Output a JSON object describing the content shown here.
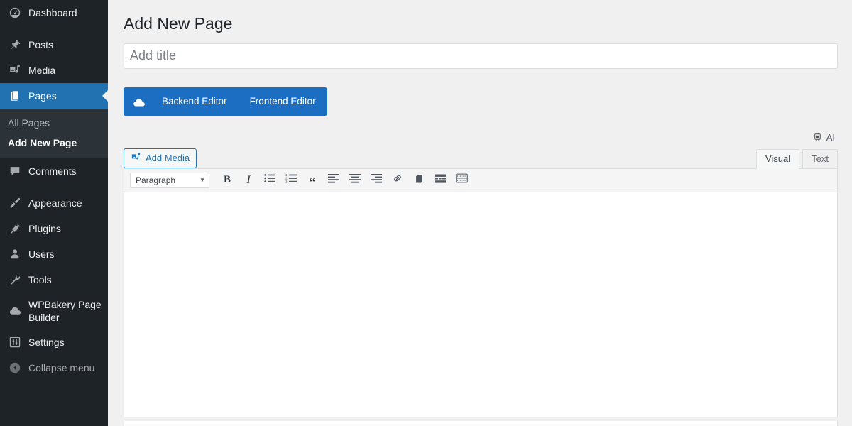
{
  "sidebar": {
    "items": [
      {
        "label": "Dashboard",
        "icon": "dashboard-icon",
        "current": false
      },
      {
        "label": "Posts",
        "icon": "pin-icon",
        "current": false
      },
      {
        "label": "Media",
        "icon": "media-icon",
        "current": false
      },
      {
        "label": "Pages",
        "icon": "pages-icon",
        "current": true
      },
      {
        "label": "Comments",
        "icon": "comments-icon",
        "current": false
      },
      {
        "label": "Appearance",
        "icon": "appearance-brush-icon",
        "current": false
      },
      {
        "label": "Plugins",
        "icon": "plugins-plug-icon",
        "current": false
      },
      {
        "label": "Users",
        "icon": "users-icon",
        "current": false
      },
      {
        "label": "Tools",
        "icon": "tools-wrench-icon",
        "current": false
      },
      {
        "label": "WPBakery Page Builder",
        "icon": "wpbakery-cloud-icon",
        "current": false
      },
      {
        "label": "Settings",
        "icon": "settings-sliders-icon",
        "current": false
      }
    ],
    "submenu": [
      {
        "label": "All Pages",
        "current": false
      },
      {
        "label": "Add New Page",
        "current": true
      }
    ],
    "collapse": {
      "label": "Collapse menu",
      "icon": "collapse-arrow-icon"
    },
    "colors": {
      "background": "#1d2327",
      "submenu_background": "#2c3338",
      "current_highlight": "#2271b1"
    }
  },
  "main": {
    "page_title": "Add New Page",
    "title_field": {
      "value": "",
      "placeholder": "Add title"
    },
    "vc_switch": {
      "logo_icon": "wpbakery-cloud-icon",
      "backend_label": "Backend Editor",
      "frontend_label": "Frontend Editor",
      "color": "#1b6ec2"
    },
    "ai_badge": {
      "label": "AI",
      "icon": "cpu-chip-icon"
    },
    "add_media": {
      "label": "Add Media",
      "icon": "media-icon",
      "color": "#2271b1"
    },
    "editor_tabs": [
      {
        "label": "Visual",
        "active": true
      },
      {
        "label": "Text",
        "active": false
      }
    ],
    "toolbar": {
      "format_select": {
        "value": "Paragraph",
        "caret": "▼"
      },
      "buttons": [
        {
          "name": "bold-button",
          "glyph": "B",
          "title": "Bold"
        },
        {
          "name": "italic-button",
          "glyph": "I",
          "title": "Italic"
        },
        {
          "name": "bulleted-list-button",
          "glyph": "",
          "title": "Bulleted list"
        },
        {
          "name": "numbered-list-button",
          "glyph": "",
          "title": "Numbered list"
        },
        {
          "name": "blockquote-button",
          "glyph": "“",
          "title": "Blockquote"
        },
        {
          "name": "align-left-button",
          "glyph": "",
          "title": "Align left"
        },
        {
          "name": "align-center-button",
          "glyph": "",
          "title": "Align center"
        },
        {
          "name": "align-right-button",
          "glyph": "",
          "title": "Align right"
        },
        {
          "name": "insert-link-button",
          "glyph": "",
          "title": "Insert/edit link"
        },
        {
          "name": "read-more-button",
          "glyph": "",
          "title": "Insert Read More tag"
        },
        {
          "name": "page-break-button",
          "glyph": "",
          "title": "Insert Page Break tag"
        },
        {
          "name": "keyboard-shortcuts-button",
          "glyph": "",
          "title": "Keyboard Shortcuts"
        }
      ]
    },
    "editor_content": ""
  }
}
